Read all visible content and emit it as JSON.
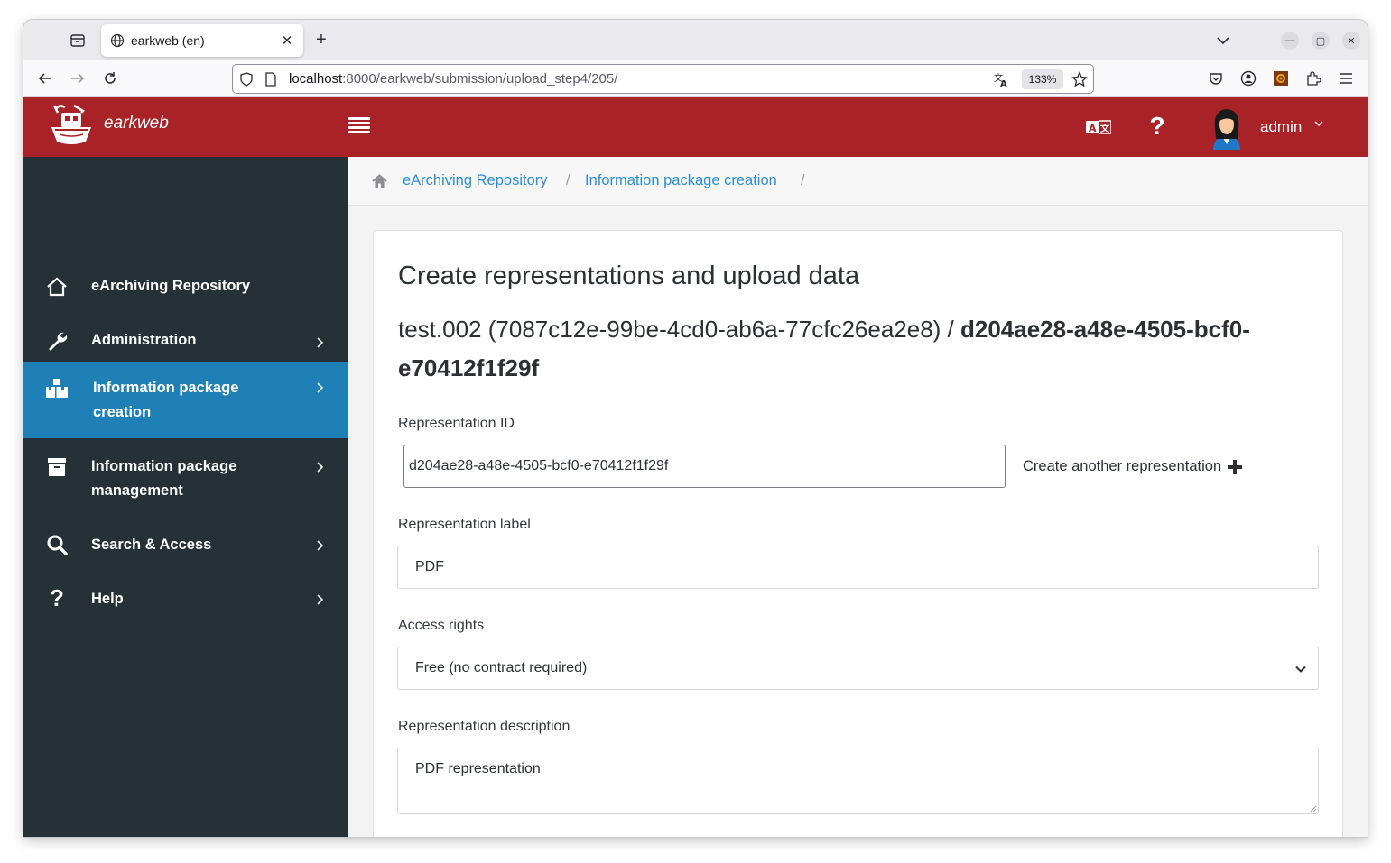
{
  "browser": {
    "tab_title": "earkweb (en)",
    "url_host": "localhost",
    "url_path": ":8000/earkweb/submission/upload_step4/205/",
    "zoom": "133%"
  },
  "header": {
    "brand": "earkweb",
    "user_name": "admin",
    "brand_color": "#a82228"
  },
  "sidebar": {
    "items": [
      {
        "label": "eArchiving Repository",
        "icon": "home-icon"
      },
      {
        "label": "Administration",
        "icon": "wrench-icon"
      },
      {
        "label_line1": "Information package",
        "label_line2": "creation",
        "icon": "boxes-icon",
        "active": true
      },
      {
        "label_line1": "Information package",
        "label_line2": "management",
        "icon": "archive-icon"
      },
      {
        "label": "Search & Access",
        "icon": "search-icon"
      },
      {
        "label": "Help",
        "icon": "question-icon"
      }
    ],
    "active_color": "#1f80b8"
  },
  "breadcrumb": {
    "items": [
      "eArchiving Repository",
      "Information package creation"
    ],
    "separator": "/"
  },
  "form": {
    "title": "Create representations and upload data",
    "subtitle_prefix": "test.002 (7087c12e-99be-4cd0-ab6a-77cfc26ea2e8) / ",
    "subtitle_bold": "d204ae28-a48e-4505-bcf0-e70412f1f29f",
    "rep_id_label": "Representation ID",
    "rep_id_value": "d204ae28-a48e-4505-bcf0-e70412f1f29f",
    "create_another": "Create another representation",
    "rep_label_label": "Representation label",
    "rep_label_value": "PDF",
    "access_label": "Access rights",
    "access_value": "Free (no contract required)",
    "desc_label": "Representation description",
    "desc_value": "PDF representation"
  }
}
